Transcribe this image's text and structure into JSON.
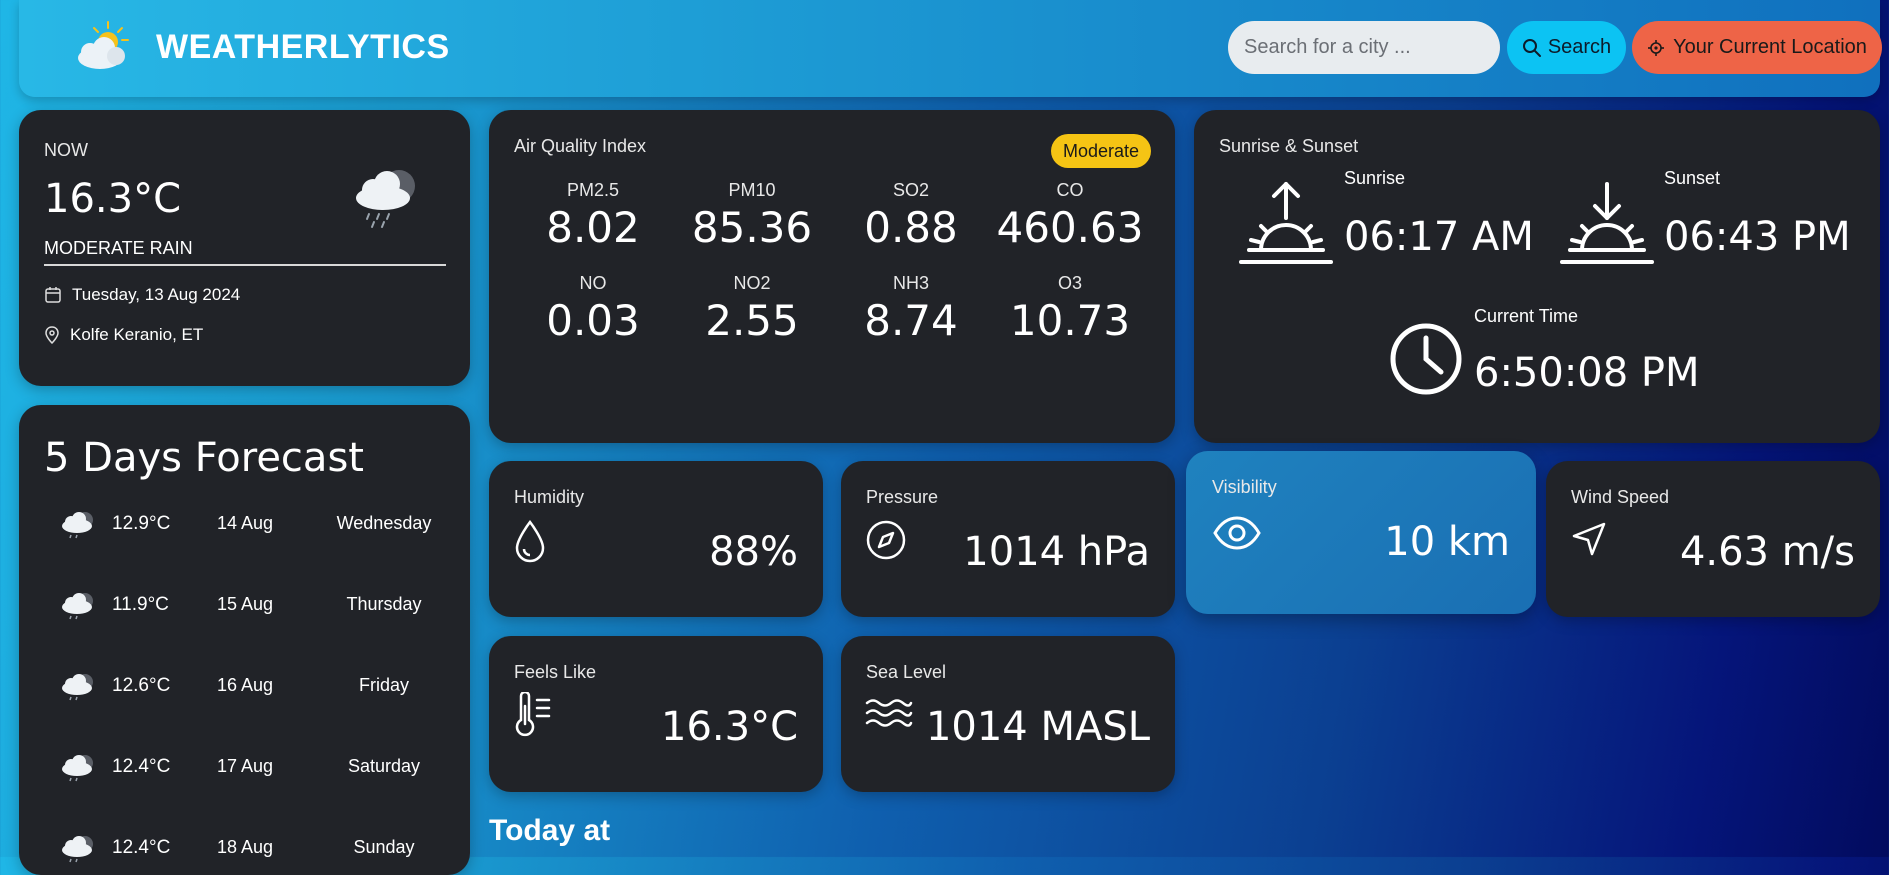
{
  "header": {
    "brand": "WEATHERLYTICS",
    "search_placeholder": "Search for a city ...",
    "search_label": "Search",
    "location_label": "Your Current Location"
  },
  "now": {
    "label": "NOW",
    "temp": "16.3°C",
    "condition": "MODERATE RAIN",
    "date": "Tuesday, 13 Aug 2024",
    "location": "Kolfe Keranio, ET"
  },
  "forecast": {
    "title": "5 Days Forecast",
    "days": [
      {
        "temp": "12.9°C",
        "date": "14 Aug",
        "day": "Wednesday"
      },
      {
        "temp": "11.9°C",
        "date": "15 Aug",
        "day": "Thursday"
      },
      {
        "temp": "12.6°C",
        "date": "16 Aug",
        "day": "Friday"
      },
      {
        "temp": "12.4°C",
        "date": "17 Aug",
        "day": "Saturday"
      },
      {
        "temp": "12.4°C",
        "date": "18 Aug",
        "day": "Sunday"
      }
    ]
  },
  "aqi": {
    "title": "Air Quality Index",
    "badge": "Moderate",
    "items": [
      {
        "key": "PM2.5",
        "value": "8.02"
      },
      {
        "key": "PM10",
        "value": "85.36"
      },
      {
        "key": "SO2",
        "value": "0.88"
      },
      {
        "key": "CO",
        "value": "460.63"
      },
      {
        "key": "NO",
        "value": "0.03"
      },
      {
        "key": "NO2",
        "value": "2.55"
      },
      {
        "key": "NH3",
        "value": "8.74"
      },
      {
        "key": "O3",
        "value": "10.73"
      }
    ]
  },
  "sun": {
    "title": "Sunrise & Sunset",
    "sunrise_label": "Sunrise",
    "sunrise": "06:17 AM",
    "sunset_label": "Sunset",
    "sunset": "06:43 PM",
    "current_label": "Current Time",
    "current": "6:50:08 PM"
  },
  "highlights": {
    "humidity_label": "Humidity",
    "humidity": "88%",
    "pressure_label": "Pressure",
    "pressure": "1014 hPa",
    "visibility_label": "Visibility",
    "visibility": "10 km",
    "wind_label": "Wind Speed",
    "wind": "4.63 m/s",
    "feels_label": "Feels Like",
    "feels": "16.3°C",
    "sea_label": "Sea Level",
    "sea": "1014 MASL"
  },
  "today_title": "Today at",
  "colors": {
    "search_btn": "#0cc3f3",
    "location_btn": "#ee6447",
    "badge": "#f5c414",
    "card": "#212328"
  }
}
